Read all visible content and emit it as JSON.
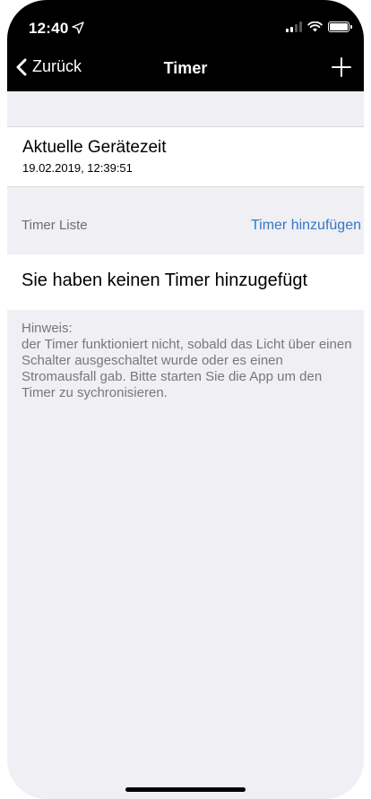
{
  "status_bar": {
    "time": "12:40",
    "location_icon": "location-arrow-icon",
    "signal_icon": "signal-icon",
    "wifi_icon": "wifi-icon",
    "battery_icon": "battery-icon"
  },
  "nav": {
    "back_label": "Zurück",
    "title": "Timer",
    "add_icon": "plus-icon"
  },
  "device": {
    "title": "Aktuelle Gerätezeit",
    "time": "19.02.2019, 12:39:51"
  },
  "timer_list": {
    "label": "Timer Liste",
    "add_label": "Timer hinzufügen",
    "empty_text": "Sie haben keinen Timer hinzugefügt"
  },
  "hint": {
    "text": "Hinweis:\n der Timer funktioniert nicht, sobald das Licht über einen Schalter ausgeschaltet wurde oder es einen Stromausfall gab. Bitte starten Sie die App um den Timer zu sychronisieren."
  },
  "colors": {
    "nav_background": "#000000",
    "page_background": "#efeff4",
    "accent": "#3478c6"
  }
}
